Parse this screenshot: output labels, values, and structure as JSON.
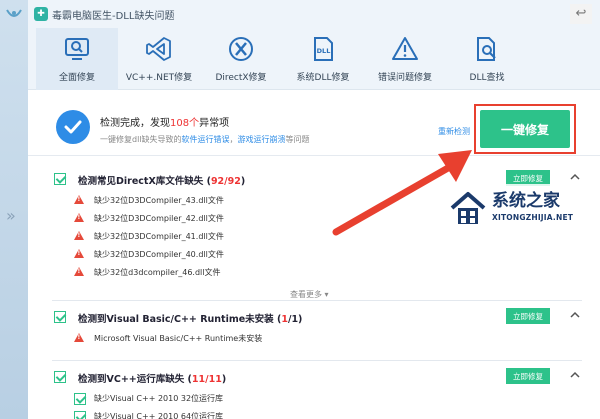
{
  "app": {
    "title": "毒霸电脑医生-DLL缺失问题",
    "back_glyph": "↩",
    "sidebar_expand": "»"
  },
  "nav": {
    "tabs": [
      {
        "label": "全面修复",
        "icon": "search-monitor-icon",
        "active": true
      },
      {
        "label": "VC++.NET修复",
        "icon": "visual-studio-icon",
        "active": false
      },
      {
        "label": "DirectX修复",
        "icon": "directx-icon",
        "active": false
      },
      {
        "label": "系统DLL修复",
        "icon": "dll-file-icon",
        "active": false
      },
      {
        "label": "错误问题修复",
        "icon": "warning-icon",
        "active": false
      },
      {
        "label": "DLL查找",
        "icon": "file-search-icon",
        "active": false
      }
    ]
  },
  "status": {
    "title_prefix": "检测完成，发现",
    "count": "108个",
    "title_suffix": "异常项",
    "sub_prefix": "一键修复dll缺失导致的",
    "sub_link1": "软件运行错误",
    "sub_sep": "，",
    "sub_link2": "游戏运行崩溃",
    "sub_suffix": "等问题",
    "rescan": "重新检测",
    "fix_all": "一键修复"
  },
  "sections": [
    {
      "title": "检测常见DirectX库文件缺失",
      "count_open": " (",
      "count": "92/92",
      "count_close": ")",
      "fix_label": "立即修复",
      "items": [
        "缺少32位D3DCompiler_43.dll文件",
        "缺少32位D3DCompiler_42.dll文件",
        "缺少32位D3DCompiler_41.dll文件",
        "缺少32位D3DCompiler_40.dll文件",
        "缺少32位d3dcompiler_46.dll文件"
      ],
      "more": "查看更多 ▾"
    },
    {
      "title": "检测到Visual Basic/C++ Runtime未安装",
      "count_open": " (",
      "count": "1",
      "count_close": "/1)",
      "fix_label": "立即修复",
      "items": [
        "Microsoft Visual Basic/C++ Runtime未安装"
      ]
    },
    {
      "title": "检测到VC++运行库缺失",
      "count_open": " (",
      "count": "11/11",
      "count_close": ")",
      "fix_label": "立即修复",
      "items": [
        "缺少Visual C++ 2010 32位运行库",
        "缺少Visual C++ 2010 64位运行库"
      ]
    }
  ],
  "watermark": {
    "name": "系统之家",
    "url": "XITONGZHIJIA.NET"
  }
}
